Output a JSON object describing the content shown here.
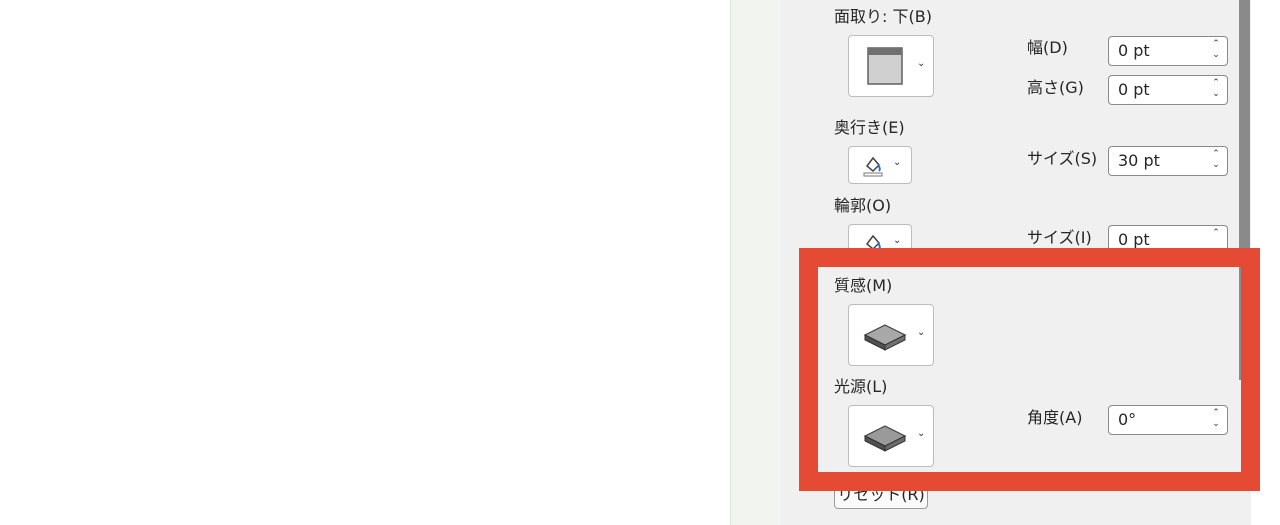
{
  "panel": {
    "bevel_bottom": {
      "label": "面取り: 下(B)",
      "width_label": "幅(D)",
      "width_value": "0 pt",
      "height_label": "高さ(G)",
      "height_value": "0 pt",
      "preset_icon": "bevel-preset-icon"
    },
    "depth": {
      "label": "奥行き(E)",
      "size_label": "サイズ(S)",
      "size_value": "30 pt",
      "color_icon": "paint-bucket-icon"
    },
    "contour": {
      "label": "輪郭(O)",
      "size_label": "サイズ(I)",
      "size_value": "0 pt",
      "color_icon": "paint-bucket-icon"
    },
    "material": {
      "label": "質感(M)",
      "preset_icon": "material-preset-icon"
    },
    "lighting": {
      "label": "光源(L)",
      "angle_label": "角度(A)",
      "angle_value": "0°",
      "preset_icon": "lighting-preset-icon"
    },
    "reset_label": "リセット(R)"
  },
  "colors": {
    "highlight": "#e44a34",
    "panel_bg": "#f0f0f0",
    "scroll_thumb": "#8a8a8a"
  }
}
